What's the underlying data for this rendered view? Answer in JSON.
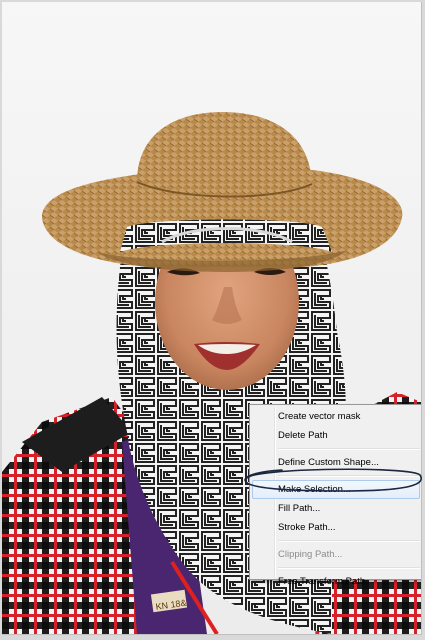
{
  "context_menu": {
    "items": [
      {
        "label": "Create vector mask",
        "enabled": true
      },
      {
        "label": "Delete Path",
        "enabled": true
      },
      {
        "label": "Define Custom Shape...",
        "enabled": true
      },
      {
        "label": "Make Selection...",
        "enabled": true,
        "highlighted": true
      },
      {
        "label": "Fill Path...",
        "enabled": true
      },
      {
        "label": "Stroke Path...",
        "enabled": true
      },
      {
        "label": "Clipping Path...",
        "enabled": false
      },
      {
        "label": "Free Transform Path",
        "enabled": true
      }
    ]
  },
  "photo": {
    "lanyard_text": "KN 18&"
  },
  "colors": {
    "menu_background": "#f0f0f0",
    "highlight_border": "#aecbeb",
    "annotation_ink": "#1a2740",
    "disabled_text": "#8c8c8c"
  }
}
